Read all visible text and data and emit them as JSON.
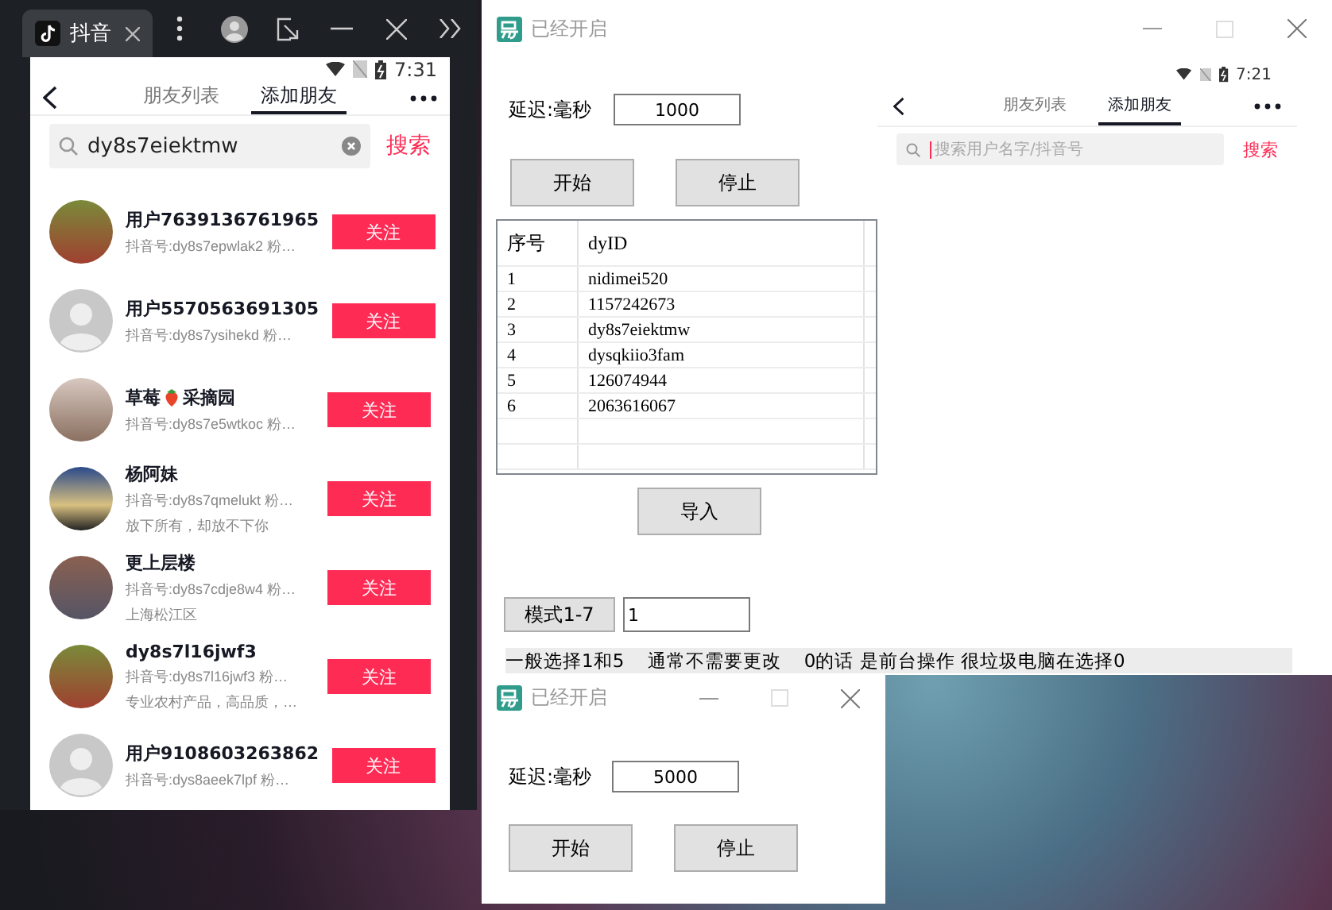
{
  "emulator": {
    "tab_title": "抖音",
    "phone": {
      "time": "7:31",
      "tabs": [
        {
          "label": "朋友列表",
          "selected": false
        },
        {
          "label": "添加朋友",
          "selected": true
        }
      ],
      "search": {
        "value": "dy8s7eiektmw"
      },
      "search_button": "搜索",
      "results": [
        {
          "name": "用户7639136761965",
          "id_line": "抖音号:dy8s7epwlak2 粉…",
          "kind": "photo",
          "follow": "关注"
        },
        {
          "name": "用户5570563691305",
          "id_line": "抖音号:dy8s7ysihekd 粉…",
          "kind": "default",
          "follow": "关注"
        },
        {
          "name": "草莓",
          "name_after_icon": "采摘园",
          "id_line": "抖音号:dy8s7e5wtkoc 粉…",
          "kind": "photo",
          "follow": "关注"
        },
        {
          "name": "杨阿妹",
          "id_line": "抖音号:dy8s7qmelukt 粉…",
          "bio": "放下所有，却放不下你",
          "kind": "photo",
          "follow": "关注"
        },
        {
          "name": "更上层楼",
          "id_line": "抖音号:dy8s7cdje8w4 粉…",
          "bio": "上海松江区",
          "kind": "photo",
          "follow": "关注"
        },
        {
          "name": "dy8s7l16jwf3",
          "id_line": "抖音号:dy8s7l16jwf3 粉…",
          "bio": "专业农村产品，高品质，…",
          "kind": "photo",
          "follow": "关注"
        },
        {
          "name": "用户9108603263862",
          "id_line": "抖音号:dys8aeek7lpf 粉…",
          "kind": "default",
          "follow": "关注"
        }
      ]
    }
  },
  "main_window": {
    "title": "已经开启",
    "delay_label": "延迟:毫秒",
    "delay_value": "1000",
    "buttons": [
      "开始",
      "停止"
    ],
    "table": {
      "columns": [
        "序号",
        "dyID"
      ],
      "rows": [
        [
          "1",
          "nidimei520"
        ],
        [
          "2",
          "1157242673"
        ],
        [
          "3",
          "dy8s7eiektmw"
        ],
        [
          "4",
          "dysqkiio3fam"
        ],
        [
          "5",
          "126074944"
        ],
        [
          "6",
          "2063616067"
        ]
      ]
    },
    "import_button": "导入",
    "mode_button": "模式1-7",
    "mode_value": "1",
    "hint": "一般选择1和5    通常不需要更改    0的话 是前台操作 很垃圾电脑在选择0",
    "mirror": {
      "time": "7:21",
      "tabs": [
        {
          "label": "朋友列表",
          "selected": false
        },
        {
          "label": "添加朋友",
          "selected": true
        }
      ],
      "search": {
        "placeholder": "搜索用户名字/抖音号"
      },
      "search_button": "搜索"
    }
  },
  "second_window": {
    "title": "已经开启",
    "delay_label": "延迟:毫秒",
    "delay_value": "5000",
    "buttons": [
      "开始",
      "停止"
    ]
  }
}
